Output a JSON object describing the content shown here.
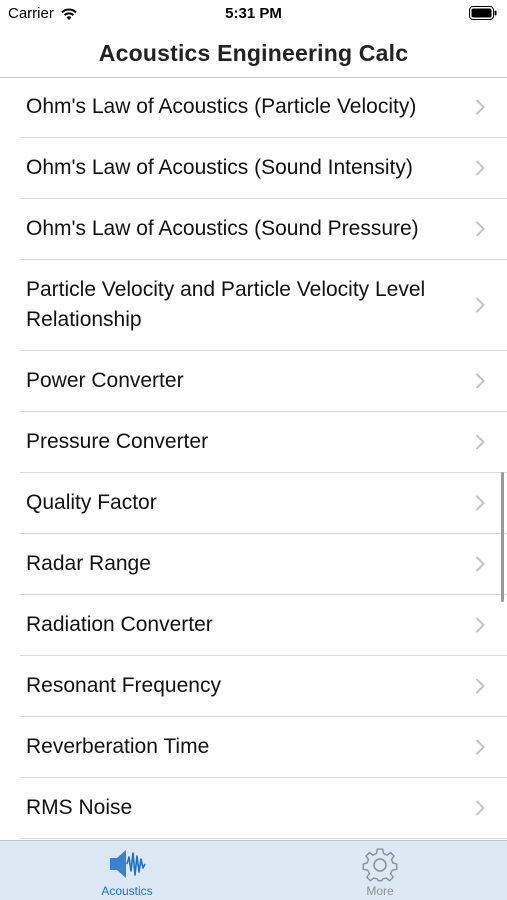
{
  "status_bar": {
    "carrier": "Carrier",
    "time": "5:31 PM"
  },
  "nav": {
    "title": "Acoustics Engineering Calc"
  },
  "list": {
    "items": [
      {
        "label": "Ohm's Law of Acoustics (Particle Velocity)"
      },
      {
        "label": "Ohm's Law of Acoustics (Sound Intensity)"
      },
      {
        "label": "Ohm's Law of Acoustics (Sound Pressure)"
      },
      {
        "label": "Particle Velocity and Particle Velocity Level Relationship"
      },
      {
        "label": "Power Converter"
      },
      {
        "label": "Pressure Converter"
      },
      {
        "label": "Quality Factor"
      },
      {
        "label": "Radar Range"
      },
      {
        "label": "Radiation Converter"
      },
      {
        "label": "Resonant Frequency"
      },
      {
        "label": "Reverberation Time"
      },
      {
        "label": "RMS Noise"
      }
    ]
  },
  "tab_bar": {
    "tabs": [
      {
        "label": "Acoustics",
        "icon": "speaker-wave-icon",
        "selected": true
      },
      {
        "label": "More",
        "icon": "gear-icon",
        "selected": false
      }
    ]
  },
  "colors": {
    "accent": "#1f6fc4",
    "tab_bar_background": "#dce8f3",
    "separator": "#d9d9de",
    "chevron": "#c4c4c7"
  }
}
